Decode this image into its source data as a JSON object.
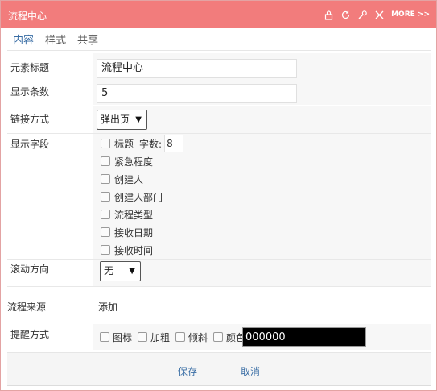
{
  "window": {
    "title": "流程中心",
    "more_label": "MORE >>",
    "accent_color": "#f27c7c",
    "icons": [
      "lock-icon",
      "refresh-icon",
      "wrench-icon",
      "close-icon"
    ]
  },
  "tabs": [
    {
      "label": "内容",
      "active": true
    },
    {
      "label": "样式",
      "active": false
    },
    {
      "label": "共享",
      "active": false
    }
  ],
  "form": {
    "element_title": {
      "label": "元素标题",
      "value": "流程中心"
    },
    "display_count": {
      "label": "显示条数",
      "value": "5"
    },
    "link_mode": {
      "label": "链接方式",
      "value": "弹出页"
    },
    "display_fields": {
      "label": "显示字段",
      "items": [
        {
          "label": "标题",
          "checked": false,
          "char_count_label": "字数:",
          "char_count": "8"
        },
        {
          "label": "紧急程度",
          "checked": false
        },
        {
          "label": "创建人",
          "checked": false
        },
        {
          "label": "创建人部门",
          "checked": false
        },
        {
          "label": "流程类型",
          "checked": false
        },
        {
          "label": "接收日期",
          "checked": false
        },
        {
          "label": "接收时间",
          "checked": false
        }
      ]
    },
    "scroll_direction": {
      "label": "滚动方向",
      "value": "无"
    },
    "flow_source": {
      "label": "流程来源",
      "action": "添加"
    },
    "remind_mode": {
      "label": "提醒方式",
      "options": [
        {
          "label": "图标",
          "checked": false
        },
        {
          "label": "加粗",
          "checked": false
        },
        {
          "label": "倾斜",
          "checked": false
        },
        {
          "label": "颜色",
          "checked": false
        }
      ],
      "color_value": "000000"
    }
  },
  "footer": {
    "save_label": "保存",
    "cancel_label": "取消"
  }
}
